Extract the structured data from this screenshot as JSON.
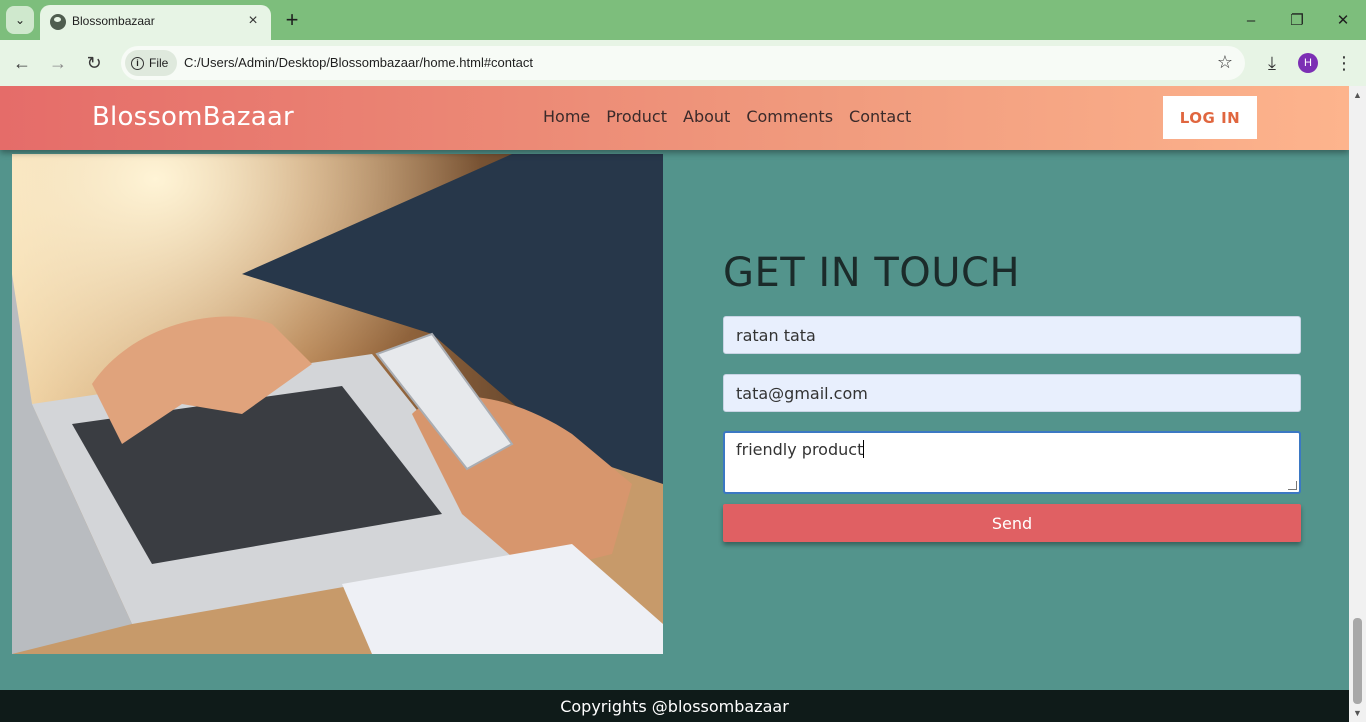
{
  "browser": {
    "tab_title": "Blossombazaar",
    "chip_label": "File",
    "url": "C:/Users/Admin/Desktop/Blossombazaar/home.html#contact",
    "profile_initial": "H"
  },
  "header": {
    "brand": "BlossomBazaar",
    "nav": [
      "Home",
      "Product",
      "About",
      "Comments",
      "Contact"
    ],
    "login_label": "LOG IN"
  },
  "contact": {
    "heading": "GET IN TOUCH",
    "name_value": "ratan tata",
    "email_value": "tata@gmail.com",
    "message_value": "friendly product",
    "send_label": "Send"
  },
  "footer": {
    "text": "Copyrights @blossombazaar"
  },
  "colors": {
    "header_start": "#e56c69",
    "header_end": "#fdb48d",
    "page_bg": "#53948c",
    "send_button": "#e06063",
    "login_text": "#e0663f"
  }
}
